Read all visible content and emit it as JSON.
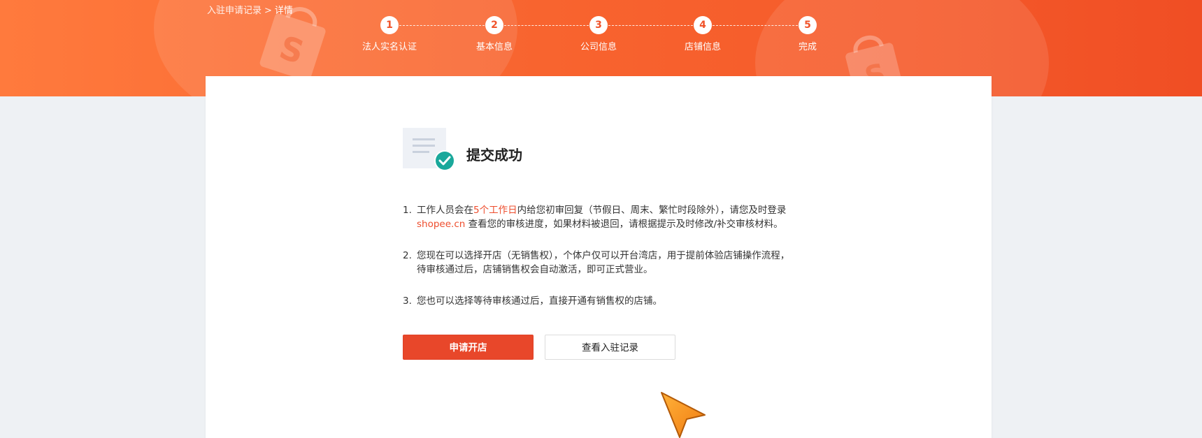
{
  "breadcrumb": {
    "parent": "入驻申请记录",
    "separator": ">",
    "current": "详情"
  },
  "steps": [
    {
      "number": "1",
      "label": "法人实名认证"
    },
    {
      "number": "2",
      "label": "基本信息"
    },
    {
      "number": "3",
      "label": "公司信息"
    },
    {
      "number": "4",
      "label": "店铺信息"
    },
    {
      "number": "5",
      "label": "完成"
    }
  ],
  "result": {
    "title": "提交成功",
    "icon": "document-check-icon"
  },
  "notes": [
    {
      "index": "1.",
      "before": "工作人员会在",
      "highlight": "5个工作日",
      "after": "内给您初审回复（节假日、周末、繁忙时段除外），请您及时登录",
      "link": "shopee.cn",
      "rest": " 查看您的审核进度，如果材料被退回，请根据提示及时修改/补交审核材料。"
    },
    {
      "index": "2.",
      "text": "您现在可以选择开店（无销售权），个体户仅可以开台湾店，用于提前体验店铺操作流程，待审核通过后，店铺销售权会自动激活，即可正式营业。"
    },
    {
      "index": "3.",
      "text": "您也可以选择等待审核通过后，直接开通有销售权的店铺。"
    }
  ],
  "actions": {
    "apply_label": "申请开店",
    "records_label": "查看入驻记录"
  },
  "colors": {
    "brand": "#ee4d2d",
    "banner_start": "#ff7a3d",
    "banner_end": "#f04e24",
    "success": "#1aa89b"
  }
}
